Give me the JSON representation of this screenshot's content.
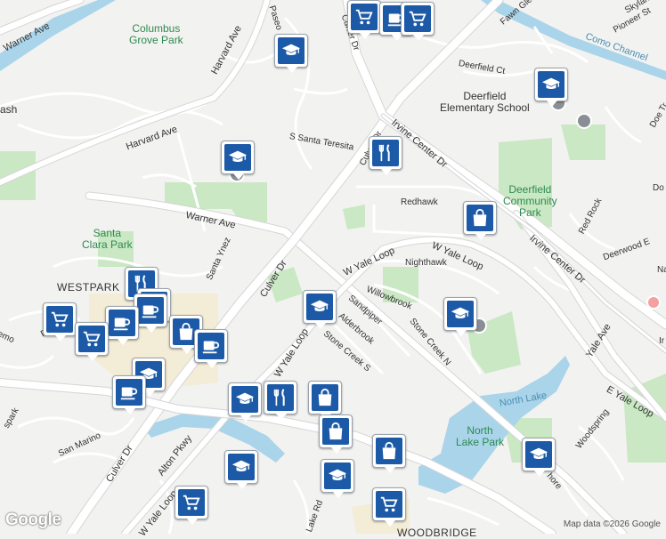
{
  "map": {
    "attribution": "Map data ©2026 Google",
    "logo": "Google",
    "colors": {
      "land": "#f2f2f0",
      "park": "#c9e8c3",
      "water": "#a9d4ea",
      "road_major": "#ffffff",
      "road_border": "#d8d8d8",
      "commercial": "#f4ecd8",
      "marker": "#1c5aa8"
    }
  },
  "labels": {
    "columbus_grove_park": "Columbus\nGrove Park",
    "warner_ave_nw": "Warner Ave",
    "harvard_ave_n": "Harvard Ave",
    "harvard_ave_w": "Harvard Ave",
    "ash": "ash",
    "paseo": "Paseo",
    "s_santa_teresita": "S Santa Teresita",
    "culver_dr_n": "Culver Dr",
    "irvine_center_dr_n": "Irvine Center Dr",
    "warner_ave": "Warner Ave",
    "santa_clara_park": "Santa\nClara Park",
    "westpark": "WESTPARK",
    "santa_ynez": "Santa Ynez",
    "culver_dr_mid": "Culver Dr",
    "redhawk": "Redhawk",
    "w_yale_loop_n": "W Yale Loop",
    "w_yale_loop_ne": "W Yale Loop",
    "nighthawk": "Nighthawk",
    "willowbrook": "Willowbrook",
    "sandpiper": "Sandpiper",
    "alderbrook": "Alderbrook",
    "stone_creek_n": "Stone Creek N",
    "stone_creek_s": "Stone Creek S",
    "w_yale_loop_s": "W Yale Loop",
    "deerfield_community_park": "Deerfield\nCommunity\nPark",
    "deerfield_elementary": "Deerfield\nElementary School",
    "deerfield_ct": "Deerfield Ct",
    "fawn_glen": "Fawn Glen W",
    "skylark": "Skylark St",
    "pioneer": "Pioneer St",
    "como_channel": "Como Channel",
    "irvine_center_dr_e": "Irvine Center Dr",
    "yale_ave": "Yale Ave",
    "e_yale_loop": "E Yale Loop",
    "north_lake": "North Lake",
    "north_lake_park": "North\nLake Park",
    "woodspring": "Woodspring",
    "red_rock": "Red Rock",
    "deerwood": "Deerwood E",
    "doe_tr": "Doe Tr",
    "alton_pkwy": "Alton Pkwy",
    "culver_dr_s": "Culver Dr",
    "w_yale_loop_sw": "W Yale Loop",
    "san_marino": "San Marino",
    "pas": "Pas",
    "emo": "emo",
    "spark": "spark",
    "lake_rd": "Lake Rd",
    "woodbridge": "WOODBRIDGE",
    "shore": "hore",
    "culver_dr_ne": "Culver Dr",
    "do": "Do",
    "na": "Na",
    "ir": "Ir"
  },
  "markers": [
    {
      "icon": "shopping-cart-icon",
      "label": "Store"
    },
    {
      "icon": "coffee-icon",
      "label": "Cafe"
    },
    {
      "icon": "shopping-cart-icon",
      "label": "Store"
    },
    {
      "icon": "school-icon",
      "label": "School"
    },
    {
      "icon": "school-icon",
      "label": "School"
    },
    {
      "icon": "restaurant-icon",
      "label": "Restaurant"
    },
    {
      "icon": "school-icon",
      "label": "School"
    },
    {
      "icon": "shopping-bag-icon",
      "label": "Shop"
    },
    {
      "icon": "school-icon",
      "label": "School"
    },
    {
      "icon": "school-icon",
      "label": "School"
    },
    {
      "icon": "restaurant-icon",
      "label": "Restaurant"
    },
    {
      "icon": "coffee-icon",
      "label": "Cafe"
    },
    {
      "icon": "coffee-icon",
      "label": "Cafe"
    },
    {
      "icon": "shopping-cart-icon",
      "label": "Store"
    },
    {
      "icon": "coffee-icon",
      "label": "Cafe"
    },
    {
      "icon": "shopping-cart-icon",
      "label": "Store"
    },
    {
      "icon": "shopping-bag-icon",
      "label": "Shop"
    },
    {
      "icon": "coffee-icon",
      "label": "Cafe"
    },
    {
      "icon": "school-icon",
      "label": "School"
    },
    {
      "icon": "coffee-icon",
      "label": "Cafe"
    },
    {
      "icon": "school-icon",
      "label": "School"
    },
    {
      "icon": "restaurant-icon",
      "label": "Restaurant"
    },
    {
      "icon": "shopping-bag-icon",
      "label": "Shop"
    },
    {
      "icon": "shopping-bag-icon",
      "label": "Shop"
    },
    {
      "icon": "shopping-bag-icon",
      "label": "Shop"
    },
    {
      "icon": "school-icon",
      "label": "School"
    },
    {
      "icon": "school-icon",
      "label": "School"
    },
    {
      "icon": "school-icon",
      "label": "School"
    },
    {
      "icon": "shopping-cart-icon",
      "label": "Store"
    },
    {
      "icon": "shopping-cart-icon",
      "label": "Store"
    }
  ]
}
